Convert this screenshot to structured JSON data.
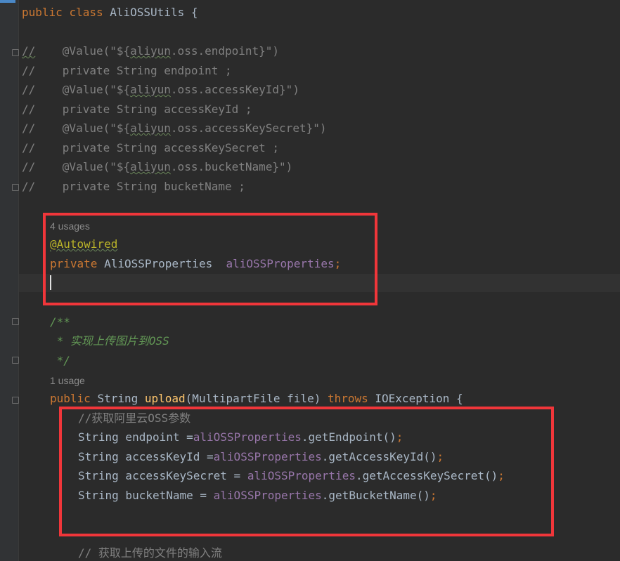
{
  "editor": {
    "class_decl": {
      "kw1": "public",
      "kw2": "class",
      "name": "AliOSSUtils",
      "brace": "{"
    },
    "commented": [
      {
        "slash": "//",
        "pre": "    @Value(\"${",
        "squig": "aliyun",
        "post": ".oss.endpoint}\")"
      },
      {
        "slash": "//",
        "pre": "    private String endpoint ;",
        "squig": "",
        "post": ""
      },
      {
        "slash": "//",
        "pre": "    @Value(\"${",
        "squig": "aliyun",
        "post": ".oss.accessKeyId}\")"
      },
      {
        "slash": "//",
        "pre": "    private String accessKeyId ;",
        "squig": "",
        "post": ""
      },
      {
        "slash": "//",
        "pre": "    @Value(\"${",
        "squig": "aliyun",
        "post": ".oss.accessKeySecret}\")"
      },
      {
        "slash": "//",
        "pre": "    private String accessKeySecret ;",
        "squig": "",
        "post": ""
      },
      {
        "slash": "//",
        "pre": "    @Value(\"${",
        "squig": "aliyun",
        "post": ".oss.bucketName}\")"
      },
      {
        "slash": "//",
        "pre": "    private String bucketName ;",
        "squig": "",
        "post": ""
      }
    ],
    "usages_hint_1": "4 usages",
    "autowired": "@Autowired",
    "field_decl": {
      "kw": "private",
      "type": "AliOSSProperties",
      "name": "aliOSSProperties",
      "semi": ";"
    },
    "javadoc": [
      "/**",
      " * 实现上传图片到OSS",
      " */"
    ],
    "usages_hint_2": "1 usage",
    "method_decl": {
      "kw1": "public",
      "type": "String",
      "name": "upload",
      "params": "(MultipartFile file) ",
      "throws": "throws",
      "rest": " IOException {"
    },
    "body": {
      "comment1": "//获取阿里云OSS参数",
      "lines": [
        {
          "left": "String endpoint =",
          "obj": "aliOSSProperties",
          "call": ".getEndpoint()",
          "semi": ";"
        },
        {
          "left": "String accessKeyId =",
          "obj": "aliOSSProperties",
          "call": ".getAccessKeyId()",
          "semi": ";"
        },
        {
          "left": "String accessKeySecret = ",
          "obj": "aliOSSProperties",
          "call": ".getAccessKeySecret()",
          "semi": ";"
        },
        {
          "left": "String bucketName = ",
          "obj": "aliOSSProperties",
          "call": ".getBucketName()",
          "semi": ";"
        }
      ],
      "comment2": "// 获取上传的文件的输入流"
    }
  },
  "highlight_color": "#f0363a"
}
